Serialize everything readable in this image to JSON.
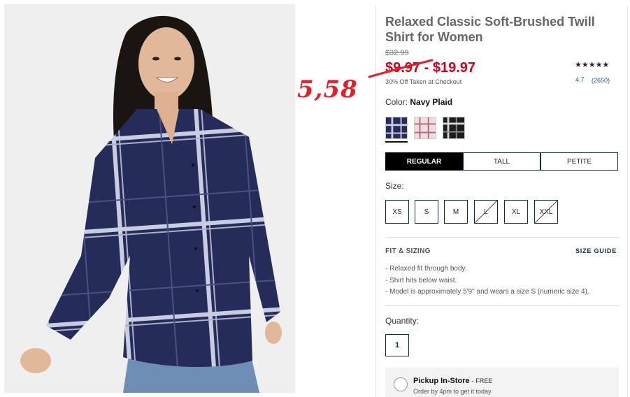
{
  "product": {
    "title": "Relaxed Classic Soft-Brushed Twill Shirt for Women",
    "original_price": "$32.99",
    "sale_price": "$9.97 - $19.97",
    "price_note": "30% Off Taken at Checkout",
    "stars": "★★★★★",
    "rating": "4.7",
    "review_count": "(2650)"
  },
  "annotation": {
    "handwritten_price": "5,58",
    "color": "#e3202a"
  },
  "color": {
    "label": "Color:",
    "selected": "Navy Plaid",
    "swatches": [
      "navy-plaid-swatch",
      "pink-plaid-swatch",
      "black-plaid-swatch"
    ]
  },
  "fit": {
    "options": [
      "REGULAR",
      "TALL",
      "PETITE"
    ],
    "selected": "REGULAR"
  },
  "size": {
    "label": "Size:",
    "options": [
      {
        "label": "XS",
        "available": true
      },
      {
        "label": "S",
        "available": true
      },
      {
        "label": "M",
        "available": true
      },
      {
        "label": "L",
        "available": false
      },
      {
        "label": "XL",
        "available": true
      },
      {
        "label": "XXL",
        "available": false
      }
    ]
  },
  "fit_sizing": {
    "heading": "FIT & SIZING",
    "size_guide": "SIZE GUIDE",
    "bullets": [
      "Relaxed fit through body.",
      "Shirt hits below waist.",
      "Model is approximately 5'9\" and wears a size S (numeric size 4)."
    ]
  },
  "quantity": {
    "label": "Quantity:",
    "value": "1"
  },
  "pickup": {
    "title": "Pickup In-Store",
    "free": "- FREE",
    "subtitle": "Order by 4pm to get it today"
  },
  "colors": {
    "navy": "#1f2652",
    "sale_red": "#d0021b",
    "link_blue": "#1a5ea8"
  }
}
